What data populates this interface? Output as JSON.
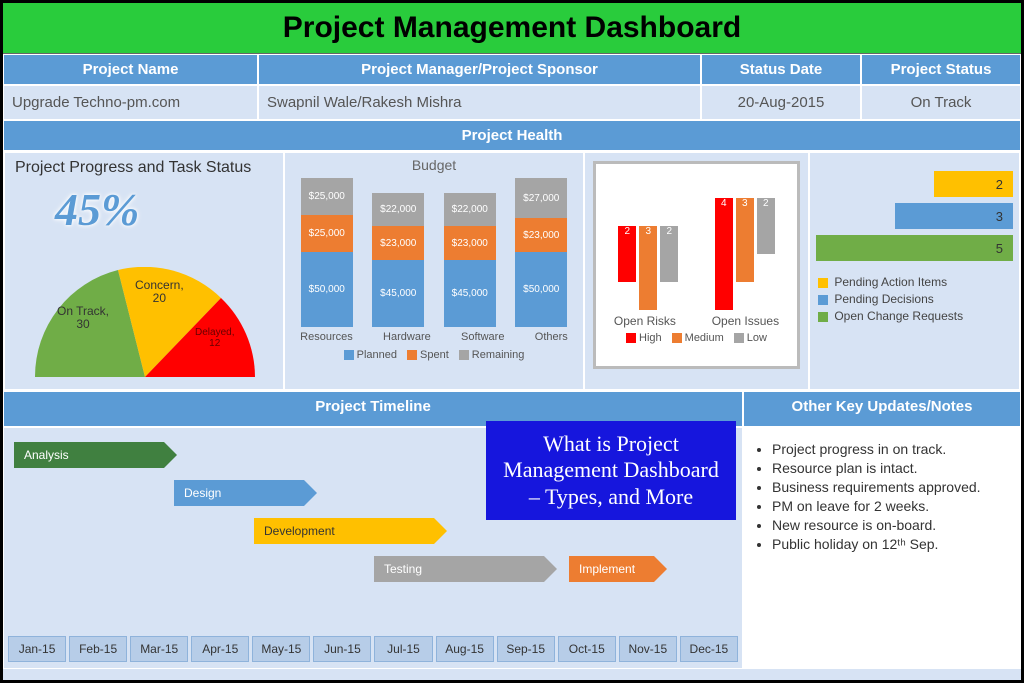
{
  "title": "Project Management Dashboard",
  "meta": {
    "headers": {
      "name": "Project Name",
      "pm": "Project Manager/Project Sponsor",
      "date": "Status Date",
      "status": "Project Status"
    },
    "values": {
      "name": "Upgrade Techno-pm.com",
      "pm": "Swapnil Wale/Rakesh Mishra",
      "date": "20-Aug-2015",
      "status": "On Track"
    }
  },
  "health_hdr": "Project Health",
  "progress": {
    "title": "Project Progress and Task Status",
    "pct": "45%",
    "segments": [
      {
        "label": "On Track,",
        "val": "30"
      },
      {
        "label": "Concern,",
        "val": "20"
      },
      {
        "label": "Delayed,",
        "val": "12"
      }
    ]
  },
  "budget": {
    "title": "Budget",
    "cats": [
      "Resources",
      "Hardware",
      "Software",
      "Others"
    ],
    "legend": [
      "Planned",
      "Spent",
      "Remaining"
    ]
  },
  "risks": {
    "xlabels": [
      "Open Risks",
      "Open Issues"
    ],
    "legend": [
      "High",
      "Medium",
      "Low"
    ]
  },
  "side": {
    "legend": [
      "Pending Action Items",
      "Pending Decisions",
      "Open Change Requests"
    ],
    "vals": [
      "2",
      "3",
      "5"
    ]
  },
  "timeline_hdr": "Project Timeline",
  "notes_hdr": "Other Key Updates/Notes",
  "phases": [
    "Analysis",
    "Design",
    "Development",
    "Testing",
    "Implement"
  ],
  "months": [
    "Jan-15",
    "Feb-15",
    "Mar-15",
    "Apr-15",
    "May-15",
    "Jun-15",
    "Jul-15",
    "Aug-15",
    "Sep-15",
    "Oct-15",
    "Nov-15",
    "Dec-15"
  ],
  "notes": [
    "Project progress in on track.",
    "Resource plan is intact.",
    "Business requirements approved.",
    "PM on leave for 2 weeks.",
    "New resource is on-board.",
    "Public holiday on 12ᵗʰ Sep."
  ],
  "overlay": "What is Project Management Dashboard – Types, and More",
  "chart_data": {
    "progress_pie": {
      "type": "pie",
      "title": "Project Progress and Task Status",
      "percent": 45,
      "series": [
        {
          "name": "On Track",
          "value": 30,
          "color": "#70ad47"
        },
        {
          "name": "Concern",
          "value": 20,
          "color": "#ffc000"
        },
        {
          "name": "Delayed",
          "value": 12,
          "color": "#ff0000"
        }
      ]
    },
    "budget": {
      "type": "bar",
      "stacked": true,
      "title": "Budget",
      "categories": [
        "Resources",
        "Hardware",
        "Software",
        "Others"
      ],
      "series": [
        {
          "name": "Planned",
          "color": "#5b9bd5",
          "values": [
            50000,
            45000,
            45000,
            50000
          ]
        },
        {
          "name": "Spent",
          "color": "#ed7d31",
          "values": [
            25000,
            23000,
            23000,
            23000
          ]
        },
        {
          "name": "Remaining",
          "color": "#a5a5a5",
          "values": [
            25000,
            22000,
            22000,
            27000
          ]
        }
      ],
      "labels": [
        [
          "$50,000",
          "$25,000",
          "$25,000"
        ],
        [
          "$45,000",
          "$23,000",
          "$22,000"
        ],
        [
          "$45,000",
          "$23,000",
          "$22,000"
        ],
        [
          "$50,000",
          "$23,000",
          "$27,000"
        ]
      ],
      "ylim": [
        0,
        100000
      ]
    },
    "risks_issues": {
      "type": "bar",
      "grouped": true,
      "categories": [
        "Open Risks",
        "Open Issues"
      ],
      "series": [
        {
          "name": "High",
          "color": "#ff0000",
          "values": [
            2,
            4
          ]
        },
        {
          "name": "Medium",
          "color": "#ed7d31",
          "values": [
            3,
            3
          ]
        },
        {
          "name": "Low",
          "color": "#a5a5a5",
          "values": [
            2,
            2
          ]
        }
      ],
      "ylim": [
        0,
        5
      ]
    },
    "side_bars": {
      "type": "bar",
      "orientation": "horizontal",
      "series": [
        {
          "name": "Pending Action Items",
          "value": 2,
          "color": "#ffc000"
        },
        {
          "name": "Pending Decisions",
          "value": 3,
          "color": "#5b9bd5"
        },
        {
          "name": "Open Change Requests",
          "value": 5,
          "color": "#70ad47"
        }
      ],
      "xlim": [
        0,
        5
      ]
    }
  }
}
